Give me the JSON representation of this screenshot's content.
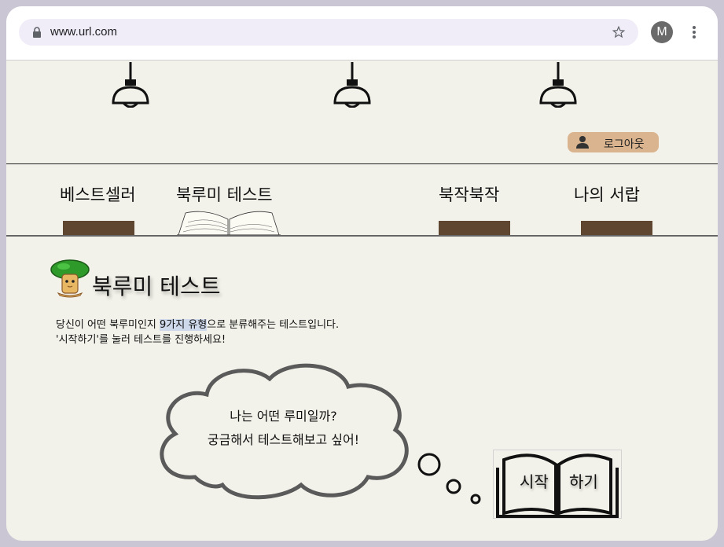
{
  "browser": {
    "url": "www.url.com",
    "avatar_letter": "M"
  },
  "header": {
    "logout_label": "로그아웃"
  },
  "nav": {
    "items": [
      {
        "label": "베스트셀러"
      },
      {
        "label": "북루미 테스트"
      },
      {
        "label": "북작북작"
      },
      {
        "label": "나의 서랍"
      }
    ],
    "active_index": 1
  },
  "main": {
    "title": "북루미 테스트",
    "desc_part1": "당신이 어떤 북루미인지 ",
    "desc_highlight": "9가지 유형",
    "desc_part2": "으로 분류해주는 테스트입니다.",
    "desc_line2": "'시작하기'를 눌러 테스트를 진행하세요!",
    "cloud_line1": "나는 어떤 루미일까?",
    "cloud_line2": "궁금해서 테스트해보고 싶어!",
    "start_part1": "시작",
    "start_part2": "하기"
  },
  "colors": {
    "page_bg": "#f3f2ea",
    "nav_bar": "#5e4630",
    "logout_bg": "#d9b48f",
    "highlight": "#cfd9ec"
  }
}
